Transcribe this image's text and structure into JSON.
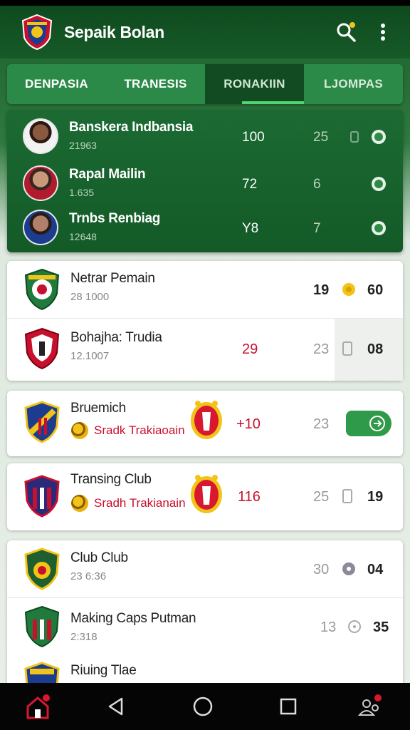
{
  "app": {
    "title": "Sepaik Bolan"
  },
  "tabs": [
    {
      "label": "DENPASIA"
    },
    {
      "label": "TRANESIS"
    },
    {
      "label": "RONAKIIN"
    },
    {
      "label": "LJOMPAS"
    }
  ],
  "featured": [
    {
      "name": "Banskera Indbansia",
      "sub": "21963",
      "v1": "100",
      "v2": "25",
      "icon": "badge-icon"
    },
    {
      "name": "Rapal Mailin",
      "sub": "1.635",
      "v1": "72",
      "v2": "6",
      "icon": "check-circle-icon"
    },
    {
      "name": "Trnbs Renbiag",
      "sub": "12648",
      "v1": "Y8",
      "v2": "7",
      "icon": "check-circle-icon"
    }
  ],
  "clubs_a": [
    {
      "name": "Netrar Pemain",
      "sub": "28 1000",
      "v1": "19",
      "v2": "60"
    },
    {
      "name": "Bohajha: Trudia",
      "sub": "12.1007",
      "v1": "29",
      "v2": "23",
      "v3": "08"
    }
  ],
  "clubs_b": [
    {
      "name": "Bruemich",
      "sub": "Sradk Trakiaoain",
      "v1": "+10",
      "v2": "23"
    },
    {
      "name": "Transing Club",
      "sub": "Sradh Trakianain",
      "v1": "116",
      "v2": "25",
      "v3": "19"
    }
  ],
  "clubs_c": [
    {
      "name": "Club Club",
      "sub": "23 6:36",
      "v1": "30",
      "v2": "04"
    },
    {
      "name": "Making Caps Putman",
      "sub": "2:318",
      "v1": "13",
      "v2": "35"
    },
    {
      "name": "Riuing Tlae",
      "sub": "",
      "v1": "",
      "v2": ""
    }
  ],
  "colors": {
    "primary": "#165a27",
    "accent": "#4fd46e",
    "highlight": "#c8102e"
  }
}
